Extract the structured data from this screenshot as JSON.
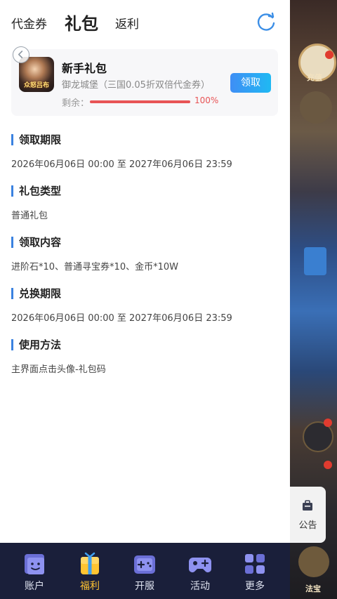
{
  "tabs": {
    "coupon": "代金券",
    "gift": "礼包",
    "rebate": "返利"
  },
  "gift": {
    "title": "新手礼包",
    "subtitle": "御龙城堡（三国0.05折双倍代金券）",
    "remain_label": "剩余：",
    "remain_percent_text": "100%",
    "remain_fraction": 1.0,
    "claim_label": "领取",
    "icon_text": "众怒吕布"
  },
  "sections": [
    {
      "title": "领取期限",
      "body": "2026年06月06日 00:00 至 2027年06月06日 23:59"
    },
    {
      "title": "礼包类型",
      "body": "普通礼包"
    },
    {
      "title": "领取内容",
      "body": "进阶石*10、普通寻宝券*10、金币*10W"
    },
    {
      "title": "兑换期限",
      "body": "2026年06月06日 00:00 至 2027年06月06日 23:59"
    },
    {
      "title": "使用方法",
      "body": "主界面点击头像-礼包码"
    }
  ],
  "notice": {
    "label": "公告"
  },
  "bottom_nav": [
    {
      "label": "账户",
      "icon": "account-icon"
    },
    {
      "label": "福利",
      "icon": "welfare-icon"
    },
    {
      "label": "开服",
      "icon": "server-open-icon"
    },
    {
      "label": "活动",
      "icon": "activity-icon"
    },
    {
      "label": "更多",
      "icon": "more-icon"
    }
  ],
  "game_overlay": {
    "recharge_text": "充值",
    "treasure_text": "法宝"
  },
  "colors": {
    "accent_blue": "#3b82e0",
    "progress_red": "#e85456",
    "bottom_bar": "#1a1f3a",
    "active_nav": "#ffc431"
  }
}
